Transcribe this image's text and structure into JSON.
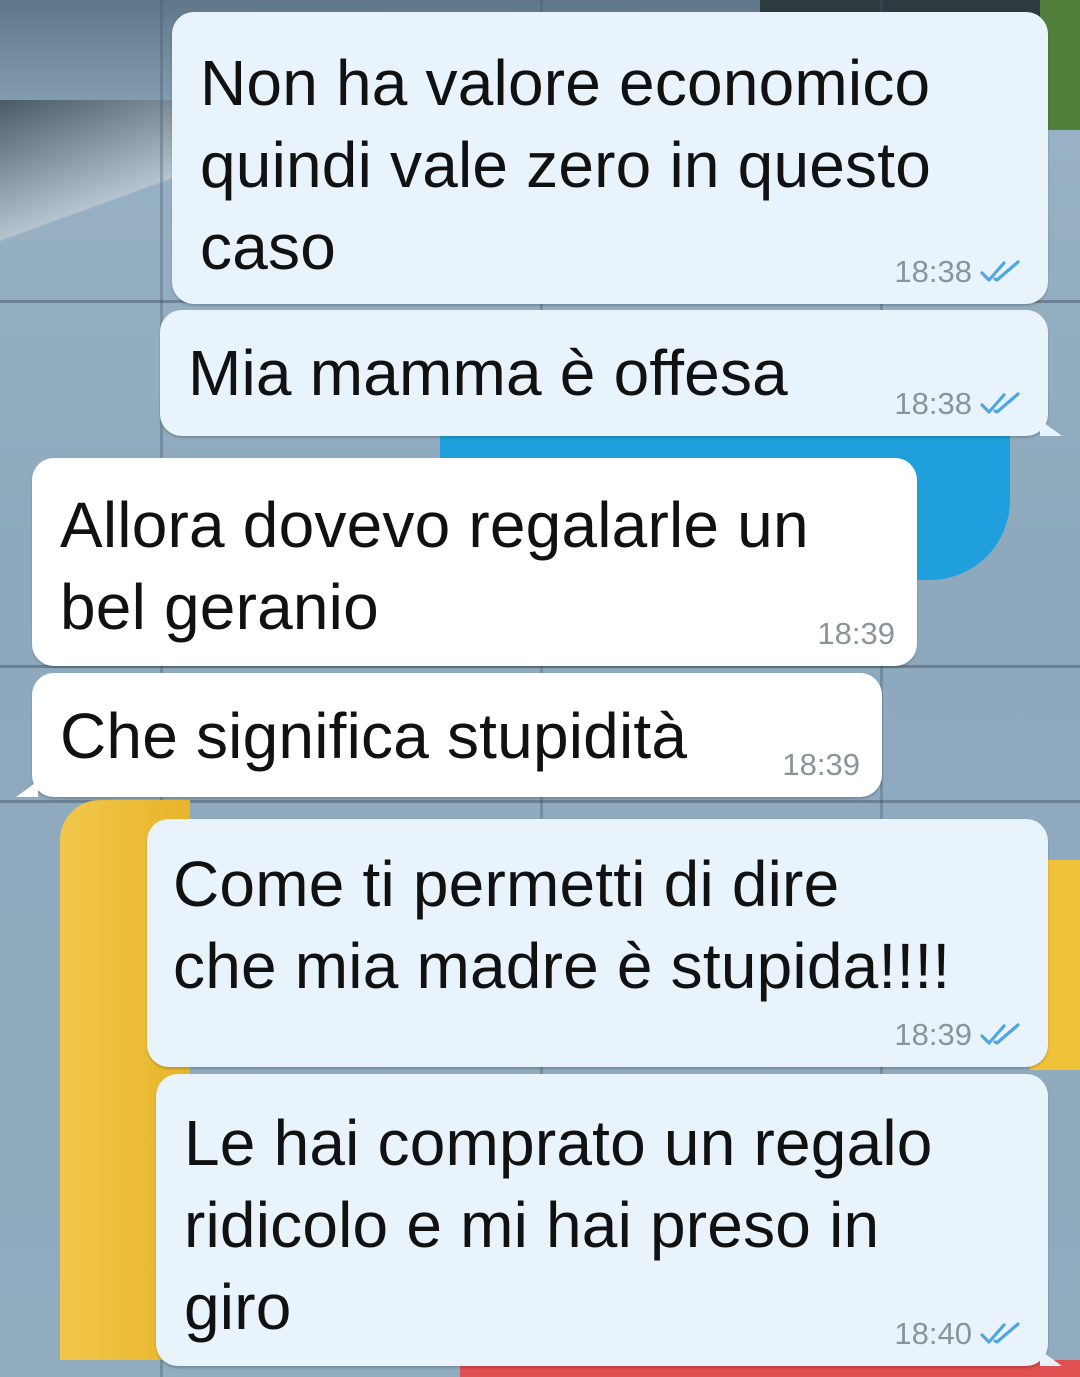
{
  "chat": {
    "messages": [
      {
        "direction": "outgoing",
        "text": "Non ha valore economico\nquindi vale zero in questo\ncaso",
        "time": "18:38",
        "status": "read"
      },
      {
        "direction": "outgoing",
        "text": "Mia mamma è offesa",
        "time": "18:38",
        "status": "read"
      },
      {
        "direction": "incoming",
        "text": "Allora dovevo regalarle un\nbel geranio",
        "time": "18:39"
      },
      {
        "direction": "incoming",
        "text": "Che significa stupidità",
        "time": "18:39"
      },
      {
        "direction": "outgoing",
        "text": "Come ti permetti di dire\nche mia madre è stupida!!!!",
        "time": "18:39",
        "status": "read"
      },
      {
        "direction": "outgoing",
        "text": "Le hai comprato un regalo\nridicolo e mi hai preso in\ngiro",
        "time": "18:40",
        "status": "read"
      }
    ]
  },
  "icons": {
    "read_receipt": "double-check-icon"
  },
  "colors": {
    "outgoing_bubble": "#e8f3fb",
    "incoming_bubble": "#ffffff",
    "read_tick": "#4fa6e0",
    "meta_text": "#8a949b"
  }
}
